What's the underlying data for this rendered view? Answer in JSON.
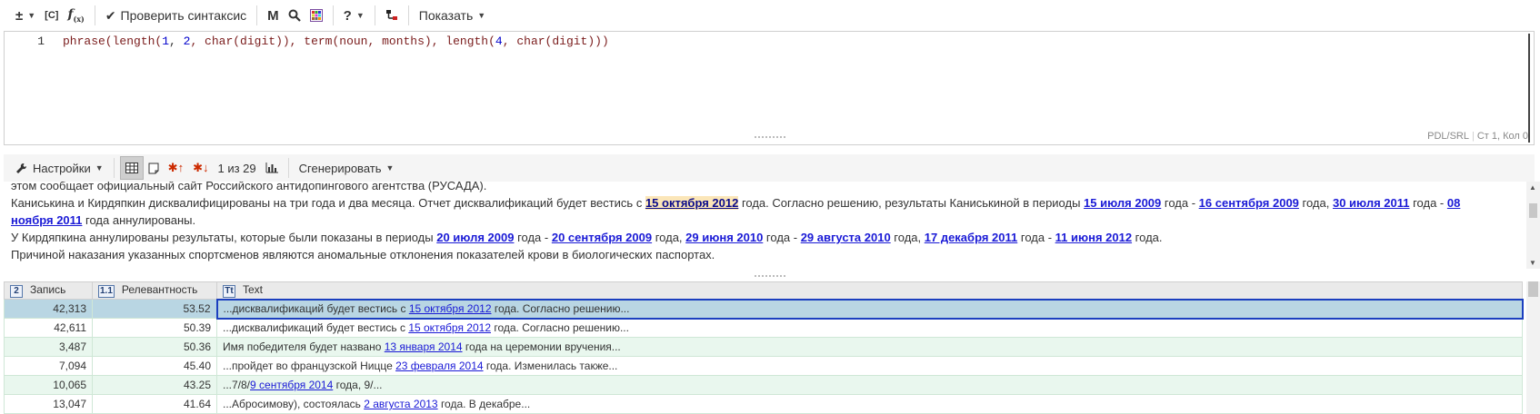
{
  "toolbar": {
    "plusminus": "±",
    "caps_label": "[C]",
    "fx_label": "f",
    "fx_sub": "(x)",
    "check_syntax": "Проверить синтаксис",
    "m_label": "M",
    "help_label": "?",
    "show_label": "Показать"
  },
  "editor": {
    "line_number": "1",
    "code": {
      "t1": "phrase(length(",
      "n1": "1",
      "t2": ", ",
      "n2": "2",
      "t3": ", char(digit)), term(noun, months), length(",
      "n3": "4",
      "t4": ", char(digit)))"
    },
    "status_lang": "PDL/SRL",
    "status_pos": "Ст 1, Кол 0"
  },
  "results_toolbar": {
    "settings": "Настройки",
    "counter": "1 из 29",
    "generate": "Сгенерировать"
  },
  "preview": {
    "l1": "этом сообщает официальный сайт Российского антидопингового агентства (РУСАДА).",
    "l2a": "Каниськина и Кирдяпкин дисквалифицированы на три года и два месяца. Отчет дисквалификаций будет вестись с ",
    "l2_link1": "15 октября 2012",
    "l2b": " года. Согласно решению, результаты Каниськиной в периоды ",
    "l2_link2": "15 июля 2009",
    "l2c": " года - ",
    "l2_link3": "16 сентября 2009",
    "l2d": " года, ",
    "l2_link4": "30 июля 2011",
    "l2e": " года - ",
    "l2_link5": "08 ноября 2011",
    "l2f": " года аннулированы.",
    "l3a": "У Кирдяпкина аннулированы результаты, которые были показаны в периоды ",
    "l3_link1": "20 июля 2009",
    "l3b": " года - ",
    "l3_link2": "20 сентября 2009",
    "l3c": " года, ",
    "l3_link3": "29 июня 2010",
    "l3d": " года - ",
    "l3_link4": "29 августа 2010",
    "l3e": " года, ",
    "l3_link5": "17 декабря 2011",
    "l3f": " года - ",
    "l3_link6": "11 июня 2012",
    "l3g": " года.",
    "l4": "Причиной наказания указанных спортсменов являются аномальные отклонения показателей крови в биологических паспортах."
  },
  "grid": {
    "headers": {
      "record_icon": "2",
      "record": "Запись",
      "relevance_icon": "1.1",
      "relevance": "Релевантность",
      "text_icon": "Tt",
      "text": "Text"
    },
    "rows": [
      {
        "record": "42,313",
        "relevance": "53.52",
        "pre": "...дисквалификаций будет вестись с ",
        "link": "15 октября 2012",
        "post": " года. Согласно решению..."
      },
      {
        "record": "42,611",
        "relevance": "50.39",
        "pre": "...дисквалификаций будет вестись с ",
        "link": "15 октября 2012",
        "post": " года. Согласно решению..."
      },
      {
        "record": "3,487",
        "relevance": "50.36",
        "pre": "Имя победителя будет названо ",
        "link": "13 января 2014",
        "post": " года на церемонии вручения..."
      },
      {
        "record": "7,094",
        "relevance": "45.40",
        "pre": "...пройдет во французской Ницце ",
        "link": "23 февраля 2014",
        "post": " года. Изменилась также..."
      },
      {
        "record": "10,065",
        "relevance": "43.25",
        "pre": "...7/8/",
        "link": "9 сентября 2014",
        "post": " года, 9/..."
      },
      {
        "record": "13,047",
        "relevance": "41.64",
        "pre": "...Абросимову), состоялась ",
        "link": "2 августа 2013",
        "post": " года. В декабре..."
      }
    ]
  },
  "colors": {
    "link": "#1a1ad6",
    "selected_row": "#b9d6e3",
    "row_alt": "#e9f7ee",
    "selection_border": "#1b3fbf",
    "star": "#cc2a00"
  }
}
